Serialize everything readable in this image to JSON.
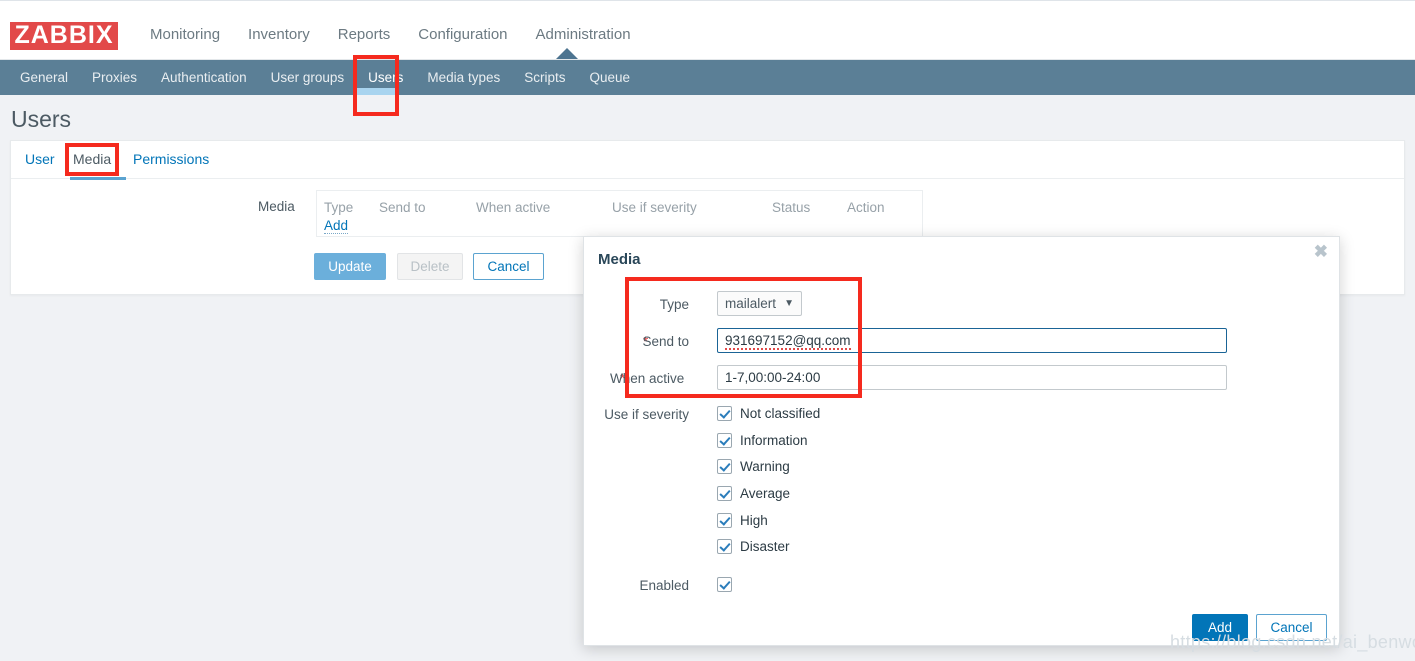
{
  "brand": {
    "logo_text": "ZABBIX",
    "logo_color": "#e24949"
  },
  "main_nav": {
    "items": [
      {
        "label": "Monitoring",
        "active": false
      },
      {
        "label": "Inventory",
        "active": false
      },
      {
        "label": "Reports",
        "active": false
      },
      {
        "label": "Configuration",
        "active": false
      },
      {
        "label": "Administration",
        "active": true
      }
    ]
  },
  "sub_nav": {
    "items": [
      {
        "label": "General",
        "active": false
      },
      {
        "label": "Proxies",
        "active": false
      },
      {
        "label": "Authentication",
        "active": false
      },
      {
        "label": "User groups",
        "active": false
      },
      {
        "label": "Users",
        "active": true
      },
      {
        "label": "Media types",
        "active": false
      },
      {
        "label": "Scripts",
        "active": false
      },
      {
        "label": "Queue",
        "active": false
      }
    ]
  },
  "page": {
    "title": "Users"
  },
  "tabs": [
    {
      "label": "User",
      "active": false
    },
    {
      "label": "Media",
      "active": true
    },
    {
      "label": "Permissions",
      "active": false
    }
  ],
  "media_section": {
    "label": "Media",
    "columns": [
      "Type",
      "Send to",
      "When active",
      "Use if severity",
      "Status",
      "Action"
    ],
    "add_link": "Add",
    "rows": []
  },
  "form_buttons": {
    "update": "Update",
    "delete": "Delete",
    "cancel": "Cancel"
  },
  "modal": {
    "title": "Media",
    "close_icon": "close-icon",
    "fields": {
      "type_label": "Type",
      "type_value": "mailalert",
      "send_to_label": "Send to",
      "send_to_value": "931697152@qq.com",
      "send_to_required": "*",
      "when_active_label": "When active",
      "when_active_value": "1-7,00:00-24:00",
      "when_active_required": "*",
      "severity_label": "Use if severity",
      "enabled_label": "Enabled"
    },
    "severities": [
      {
        "label": "Not classified",
        "checked": true
      },
      {
        "label": "Information",
        "checked": true
      },
      {
        "label": "Warning",
        "checked": true
      },
      {
        "label": "Average",
        "checked": true
      },
      {
        "label": "High",
        "checked": true
      },
      {
        "label": "Disaster",
        "checked": true
      }
    ],
    "enabled_checked": true,
    "footer": {
      "add": "Add",
      "cancel": "Cancel"
    }
  },
  "watermark": {
    "text": "https://blog.csdn.net/ai_benwoniu"
  }
}
